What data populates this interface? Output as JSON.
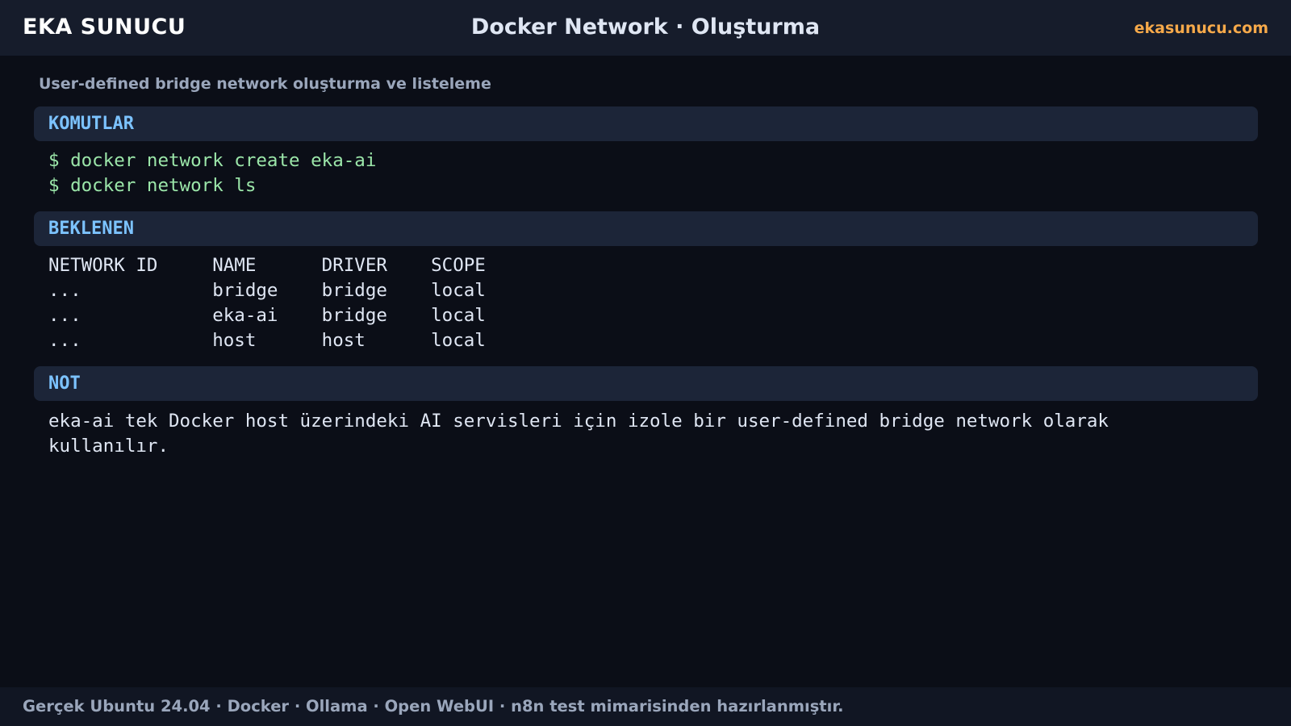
{
  "header": {
    "brand": "EKA SUNUCU",
    "title": "Docker Network · Oluşturma",
    "site": "ekasunucu.com"
  },
  "subtitle": "User-defined bridge network oluşturma ve listeleme",
  "sections": {
    "commands": {
      "label": "KOMUTLAR",
      "lines": [
        "$ docker network create eka-ai",
        "$ docker network ls"
      ]
    },
    "expected": {
      "label": "BEKLENEN",
      "lines": [
        "NETWORK ID     NAME      DRIVER    SCOPE",
        "...            bridge    bridge    local",
        "...            eka-ai    bridge    local",
        "...            host      host      local"
      ]
    },
    "note": {
      "label": "NOT",
      "text": "eka-ai tek Docker host üzerindeki AI servisleri için izole bir user-defined bridge network olarak kullanılır."
    }
  },
  "footer": {
    "text": "Gerçek Ubuntu 24.04 · Docker · Ollama · Open WebUI · n8n test mimarisinden hazırlanmıştır."
  },
  "colors": {
    "background": "#0b0e17",
    "topbar": "#161c2b",
    "section_header_bg": "#1c2538",
    "section_label": "#7cc3ff",
    "command_text": "#9be6a9",
    "output_text": "#dfe6f3",
    "site_accent": "#f6a94a",
    "muted_text": "#9aa6bb"
  }
}
